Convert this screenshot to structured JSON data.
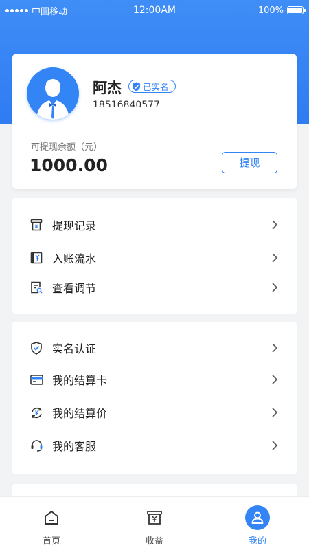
{
  "status_bar": {
    "carrier": "中国移动",
    "time": "12:00AM",
    "battery": "100%"
  },
  "profile": {
    "name": "阿杰",
    "verified_badge": "已实名",
    "phone": "18516840577",
    "balance_label": "可提现余额（元）",
    "balance_value": "1000.00",
    "withdraw_button": "提现"
  },
  "menu_group_1": [
    {
      "label": "提现记录",
      "icon": "receipt-icon"
    },
    {
      "label": "入账流水",
      "icon": "ledger-icon"
    },
    {
      "label": "查看调节",
      "icon": "document-search-icon"
    }
  ],
  "menu_group_2": [
    {
      "label": "实名认证",
      "icon": "shield-check-icon"
    },
    {
      "label": "我的结算卡",
      "icon": "card-icon"
    },
    {
      "label": "我的结算价",
      "icon": "exchange-icon"
    },
    {
      "label": "我的客服",
      "icon": "headset-icon"
    }
  ],
  "tabbar": [
    {
      "label": "首页",
      "icon": "home-icon",
      "active": false
    },
    {
      "label": "收益",
      "icon": "wallet-icon",
      "active": false
    },
    {
      "label": "我的",
      "icon": "user-icon",
      "active": true
    }
  ],
  "colors": {
    "accent": "#3384f5",
    "hero": "#3f8df6",
    "background": "#f2f3f5"
  }
}
